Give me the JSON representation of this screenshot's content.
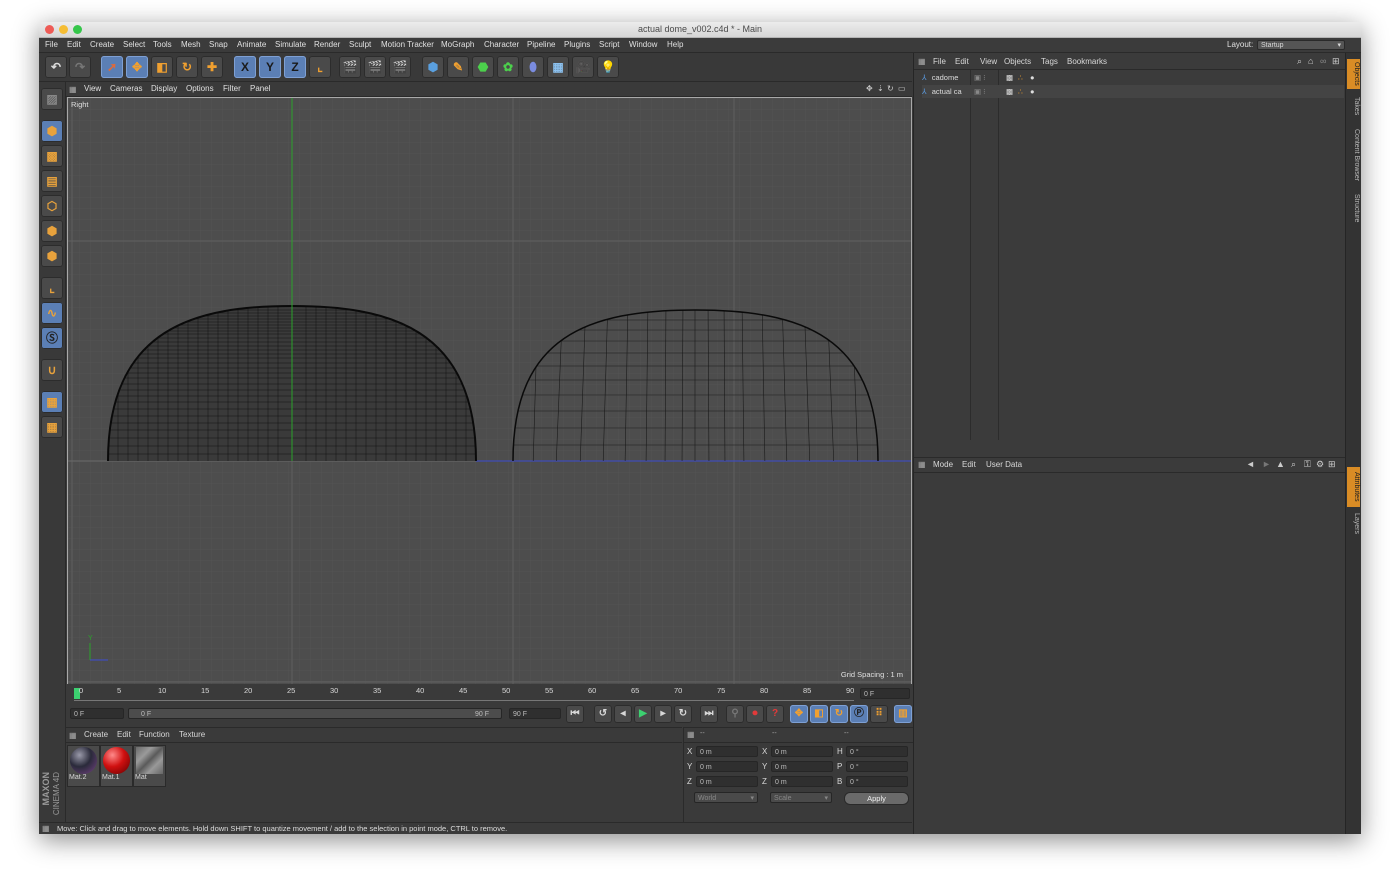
{
  "window": {
    "title": "actual dome_v002.c4d * - Main"
  },
  "menubar": {
    "items": [
      "File",
      "Edit",
      "Create",
      "Select",
      "Tools",
      "Mesh",
      "Snap",
      "Animate",
      "Simulate",
      "Render",
      "Sculpt",
      "Motion Tracker",
      "MoGraph",
      "Character",
      "Pipeline",
      "Plugins",
      "Script",
      "Window",
      "Help"
    ],
    "layout_label": "Layout:",
    "layout_value": "Startup"
  },
  "toolbar": {
    "axis_x": "X",
    "axis_y": "Y",
    "axis_z": "Z"
  },
  "viewport": {
    "menu": [
      "View",
      "Cameras",
      "Display",
      "Options",
      "Filter",
      "Panel"
    ],
    "view_name": "Right",
    "grid_spacing": "Grid Spacing : 1 m",
    "axis_y_label": "Y"
  },
  "timeline": {
    "ticks": [
      "0",
      "5",
      "10",
      "15",
      "20",
      "25",
      "30",
      "35",
      "40",
      "45",
      "50",
      "55",
      "60",
      "65",
      "70",
      "75",
      "80",
      "85",
      "90"
    ],
    "current_frame": "0 F",
    "start_frame": "0 F",
    "range_start": "0 F",
    "range_end": "90 F",
    "end_frame": "90 F"
  },
  "materials": {
    "menu": [
      "Create",
      "Edit",
      "Function",
      "Texture"
    ],
    "items": [
      {
        "name": "Mat.2"
      },
      {
        "name": "Mat.1"
      },
      {
        "name": "Mat"
      }
    ]
  },
  "coordinates": {
    "headers": [
      "--",
      "--",
      "--"
    ],
    "rows": [
      {
        "a": "X",
        "av": "0 m",
        "b": "X",
        "bv": "0 m",
        "c": "H",
        "cv": "0 °"
      },
      {
        "a": "Y",
        "av": "0 m",
        "b": "Y",
        "bv": "0 m",
        "c": "P",
        "cv": "0 °"
      },
      {
        "a": "Z",
        "av": "0 m",
        "b": "Z",
        "bv": "0 m",
        "c": "B",
        "cv": "0 °"
      }
    ],
    "world": "World",
    "scale": "Scale",
    "apply": "Apply"
  },
  "brand": {
    "line1": "MAXON",
    "line2": "CINEMA 4D"
  },
  "status": {
    "text": "Move: Click and drag to move elements. Hold down SHIFT to quantize movement / add to the selection in point mode, CTRL to remove."
  },
  "objects": {
    "menu": [
      "File",
      "Edit",
      "View",
      "Objects",
      "Tags",
      "Bookmarks"
    ],
    "items": [
      {
        "name": "cadome"
      },
      {
        "name": "actual ca"
      }
    ]
  },
  "attributes": {
    "menu": [
      "Mode",
      "Edit",
      "User Data"
    ]
  },
  "side_tabs": [
    "Objects",
    "Takes",
    "Content Browser",
    "Structure"
  ],
  "side_tabs_lower": [
    "Attributes",
    "Layers"
  ],
  "colors": {
    "accent": "#d98c25",
    "selection": "#5b7fb5",
    "viewport_bg": "#4d4d4d",
    "green_axis": "#2aa32a",
    "blue_axis": "#3a4bd1"
  }
}
